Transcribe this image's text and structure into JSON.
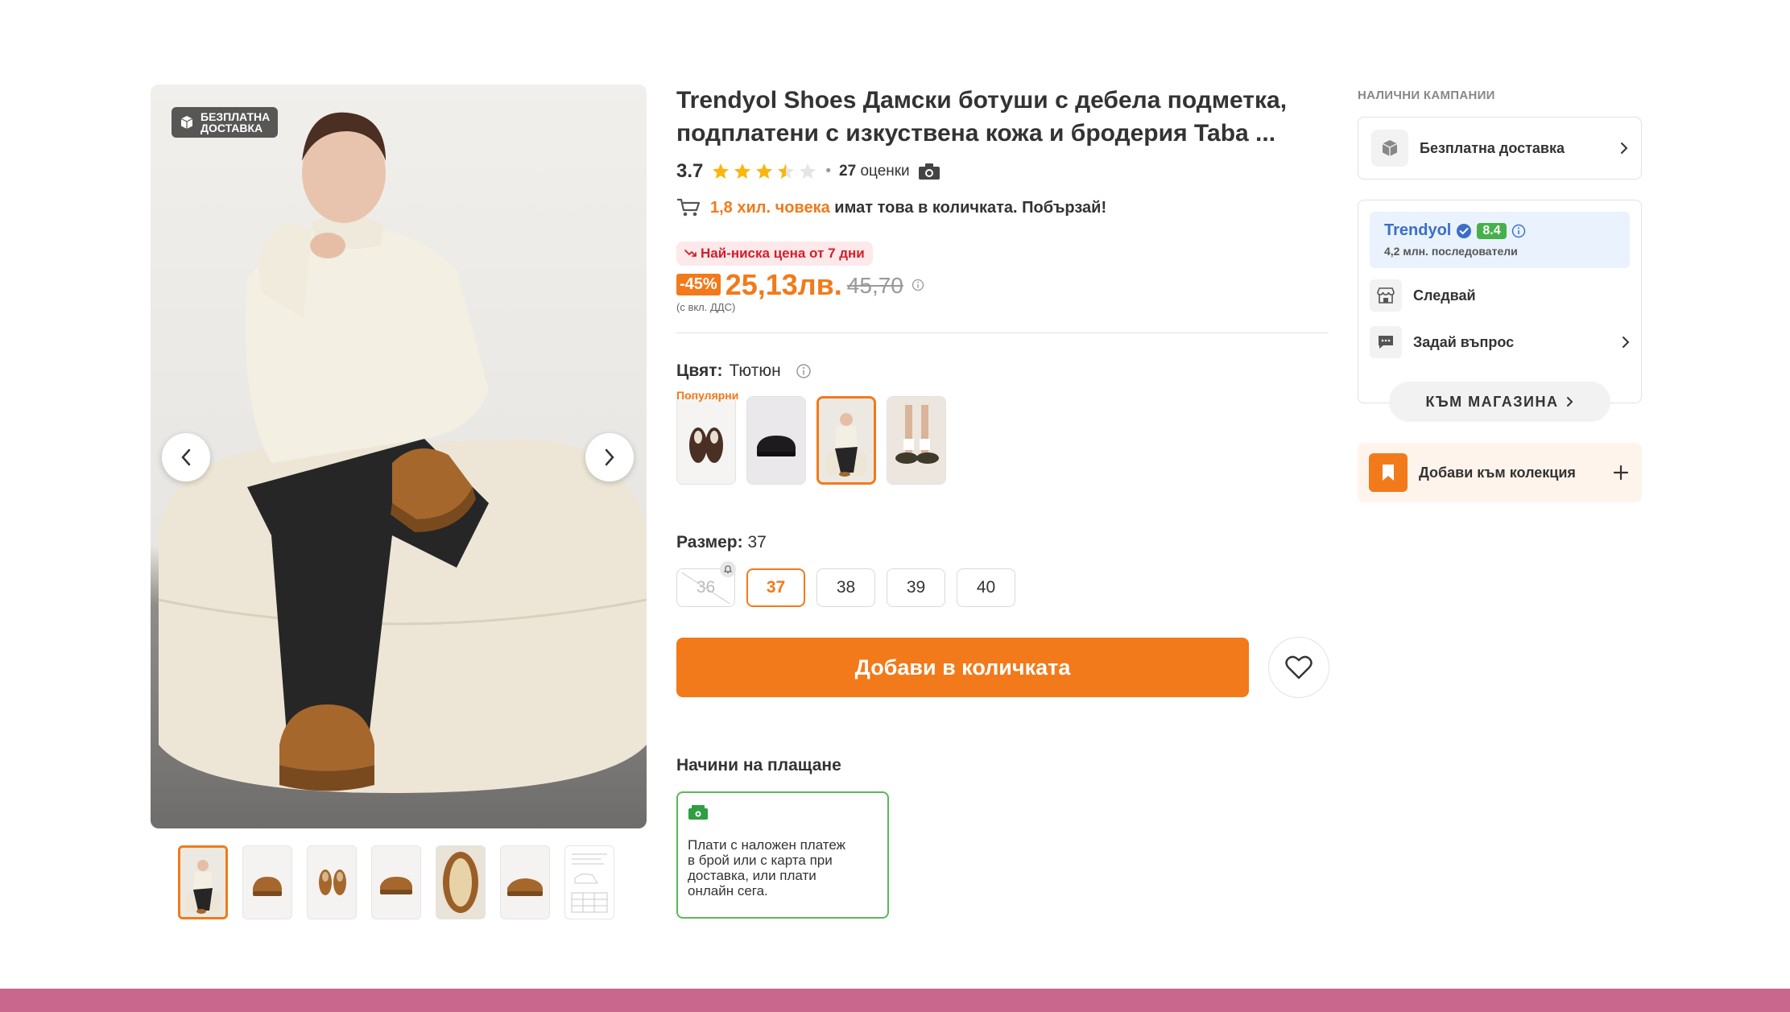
{
  "product": {
    "brand": "Trendyol Shoes",
    "name_line": "Дамски ботуши с дебела подметка, подплатени с изкуствена кожа и бродерия Taba ...",
    "rating": "3.7",
    "rating_stars": 3.5,
    "reviews_count": "27",
    "reviews_label": "оценки",
    "free_shipping_badge": [
      "БЕЗПЛАТНА",
      "ДОСТАВКА"
    ]
  },
  "social_proof": {
    "highlight": "1,8 хил. човека",
    "text": "имат това в количката. Побързай!"
  },
  "price": {
    "lowest_badge": "Най-ниска цена от 7 дни",
    "discount": "-45%",
    "current": "25,13лв.",
    "old": "45,70",
    "vat_note": "(с вкл. ДДС)"
  },
  "color": {
    "label": "Цвят:",
    "value": "Тютюн",
    "popular_tag": "Популярни",
    "selected_index": 2,
    "swatch_count": 4
  },
  "size": {
    "label": "Размер:",
    "value": "37",
    "options": [
      "36",
      "37",
      "38",
      "39",
      "40"
    ],
    "disabled": [
      "36"
    ],
    "selected": "37"
  },
  "cart": {
    "add_label": "Добави в количката"
  },
  "payment": {
    "title": "Начини на плащане",
    "method_text": "Плати с наложен платеж в брой или с карта при доставка, или плати онлайн сега."
  },
  "campaigns": {
    "title": "НАЛИЧНИ КАМПАНИИ",
    "items": [
      "Безплатна доставка"
    ]
  },
  "seller": {
    "name": "Trendyol",
    "score": "8.4",
    "followers": "4,2 млн. последователи",
    "follow_label": "Следвай",
    "ask_label": "Задай въпрос",
    "store_label": "КЪМ МАГАЗИНА"
  },
  "collection": {
    "label": "Добави към колекция"
  },
  "gallery": {
    "thumb_count": 7,
    "active_index": 0
  },
  "colors": {
    "accent": "#f27a1a",
    "sale_red": "#d21f2c",
    "seller_blue": "#3a6ec7",
    "score_green": "#47b04b",
    "bottom_bar": "#c9678d"
  }
}
